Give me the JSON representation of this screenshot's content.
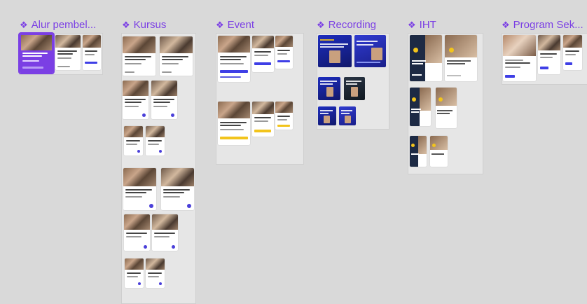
{
  "sections": {
    "alur": {
      "title": "Alur pembel..."
    },
    "kursus": {
      "title": "Kursus"
    },
    "event": {
      "title": "Event"
    },
    "recording": {
      "title": "Recording"
    },
    "iht": {
      "title": "IHT"
    },
    "program": {
      "title": "Program Sek..."
    }
  },
  "icons": {
    "section_marker": "diamond-component-icon"
  },
  "colors": {
    "accent": "#7b3fe4",
    "canvas": "#d9d9d9",
    "frame": "#e6e6e6",
    "button_blue": "#3f3fe6",
    "button_yellow": "#f2c41c",
    "banner_blue": "#1d2dbf"
  }
}
